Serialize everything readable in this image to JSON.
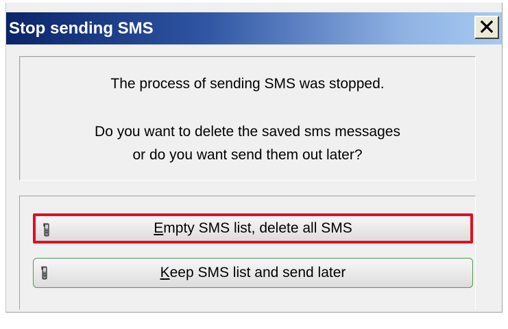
{
  "window": {
    "title": "Stop sending SMS",
    "close_label": "✕"
  },
  "message": {
    "line1": "The process of sending SMS was stopped.",
    "line2": "Do you want to delete the saved sms messages",
    "line3": "or do you want send them out later?"
  },
  "buttons": {
    "empty": {
      "mnemonic": "E",
      "rest": "mpty SMS list, delete all SMS",
      "icon": "mobile-phone-icon"
    },
    "keep": {
      "mnemonic": "K",
      "rest": "eep SMS list and send later",
      "icon": "mobile-phone-icon"
    }
  },
  "colors": {
    "title_bar_start": "#0a246a",
    "title_bar_end": "#a6caf0",
    "highlight_border": "#e01020",
    "keep_border": "#4e9a4e"
  }
}
